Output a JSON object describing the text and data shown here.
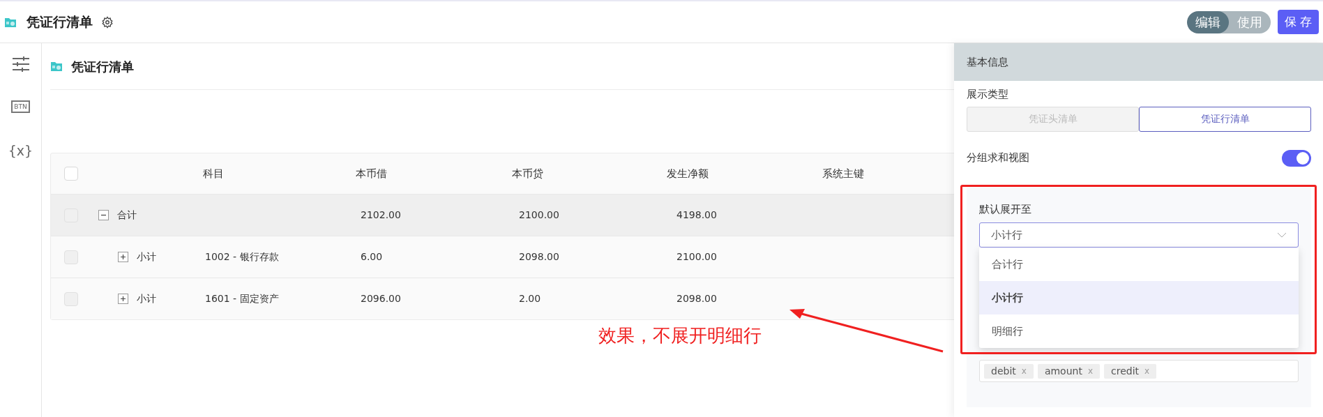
{
  "app": {
    "title": "凭证行清单"
  },
  "mode_toggle": [
    {
      "label": "编辑",
      "selected": true
    },
    {
      "label": "使用",
      "selected": false
    }
  ],
  "save_button": "保 存",
  "sidebar": {
    "items": [
      {
        "kind": "sliders"
      },
      {
        "kind": "label",
        "text": "BTN"
      },
      {
        "kind": "label",
        "text": "{x}"
      }
    ]
  },
  "page_title": "凭证行清单",
  "table": {
    "header_checked": false,
    "columns": [
      "科目",
      "本币借",
      "本币贷",
      "发生净额",
      "系统主键"
    ],
    "rows": [
      {
        "label": "合计",
        "checked": false,
        "expanded": true,
        "debit": "2102.00",
        "credit": "2100.00",
        "net": "4198.00",
        "children": [
          {
            "label": "小计",
            "checked": false,
            "expanded": false,
            "account": "1002 - 银行存款",
            "debit": "6.00",
            "credit": "2098.00",
            "net": "2100.00"
          },
          {
            "label": "小计",
            "checked": false,
            "expanded": false,
            "account": "1601 - 固定资产",
            "debit": "2096.00",
            "credit": "2.00",
            "net": "2098.00"
          }
        ]
      }
    ]
  },
  "annotation": {
    "text": "效果，不展开明细行"
  },
  "panel": {
    "section": "基本信息",
    "display_type": {
      "label": "展示类型",
      "options": [
        {
          "label": "凭证头清单",
          "selected": false
        },
        {
          "label": "凭证行清单",
          "selected": true
        }
      ]
    },
    "group_sum": {
      "label": "分组求和视图",
      "on": true
    },
    "expand_to": {
      "label": "默认展开至",
      "value": "小计行",
      "options": [
        {
          "label": "合计行",
          "selected": false
        },
        {
          "label": "小计行",
          "selected": true
        },
        {
          "label": "明细行",
          "selected": false
        }
      ]
    },
    "tags": [
      {
        "label": "debit",
        "remove": "x"
      },
      {
        "label": "amount",
        "remove": "x"
      },
      {
        "label": "credit",
        "remove": "x"
      }
    ]
  }
}
